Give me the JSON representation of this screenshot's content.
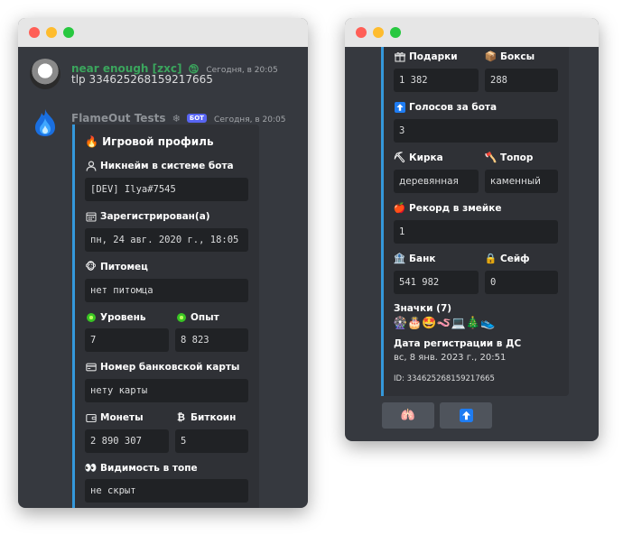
{
  "left_window": {
    "message1": {
      "username": "near enough [zxc]",
      "status_icon": "🕲",
      "timestamp": "Сегодня, в 20:05",
      "text": "tlp 334625268159217665"
    },
    "message2": {
      "username": "FlameOut Tests",
      "verified_icon": "❄",
      "bot_tag": "БОТ",
      "timestamp": "Сегодня, в 20:05",
      "embed": {
        "title": "Игровой профиль",
        "title_icon": "🔥",
        "nickname_label": "Никнейм в системе бота",
        "nickname_value": "[DEV] Ilya#7545",
        "registered_label": "Зарегистрирован(а)",
        "registered_value": "пн, 24 авг. 2020 г., 18:05",
        "pet_label": "Питомец",
        "pet_icon": "🐵",
        "pet_value": "нет питомца",
        "level_label": "Уровень",
        "level_value": "7",
        "exp_label": "Опыт",
        "exp_value": "8 823",
        "card_label": "Номер банковской карты",
        "card_value": "нету карты",
        "coins_label": "Монеты",
        "coins_value": "2 890 307",
        "bitcoin_label": "Биткоин",
        "bitcoin_icon": "₿",
        "bitcoin_value": "5",
        "visibility_label": "Видимость в топе",
        "visibility_icon": "👀",
        "visibility_value": "не скрыт"
      }
    }
  },
  "right_window": {
    "gifts_label": "Подарки",
    "gifts_value": "1 382",
    "boxes_label": "Боксы",
    "boxes_icon": "📦",
    "boxes_value": "288",
    "votes_label": "Голосов за бота",
    "votes_icon": "⬆",
    "votes_value": "3",
    "pickaxe_label": "Кирка",
    "pickaxe_icon": "⛏",
    "pickaxe_value": "деревянная",
    "axe_label": "Топор",
    "axe_icon": "🪓",
    "axe_value": "каменный",
    "snake_label": "Рекорд в змейке",
    "snake_icon": "🍎",
    "snake_value": "1",
    "bank_label": "Банк",
    "bank_icon": "🏦",
    "bank_value": "541 982",
    "safe_label": "Сейф",
    "safe_icon": "🔒",
    "safe_value": "0",
    "badges_label": "Значки (7)",
    "badges": "🎡🎂🤩🪱💻🎄👟",
    "ds_label": "Дата регистрации в ДС",
    "ds_value": "вс, 8 янв. 2023 г., 20:51",
    "id_text": "ID: 334625268159217665",
    "button1_icon": "🫁",
    "button2_icon": "⬆"
  },
  "colors": {
    "background": "#36393f",
    "embed_bg": "#2f3136",
    "embed_accent": "#3498db",
    "code_bg": "#202225",
    "username_green": "#3ba55d",
    "bot_tag": "#5865f2"
  }
}
